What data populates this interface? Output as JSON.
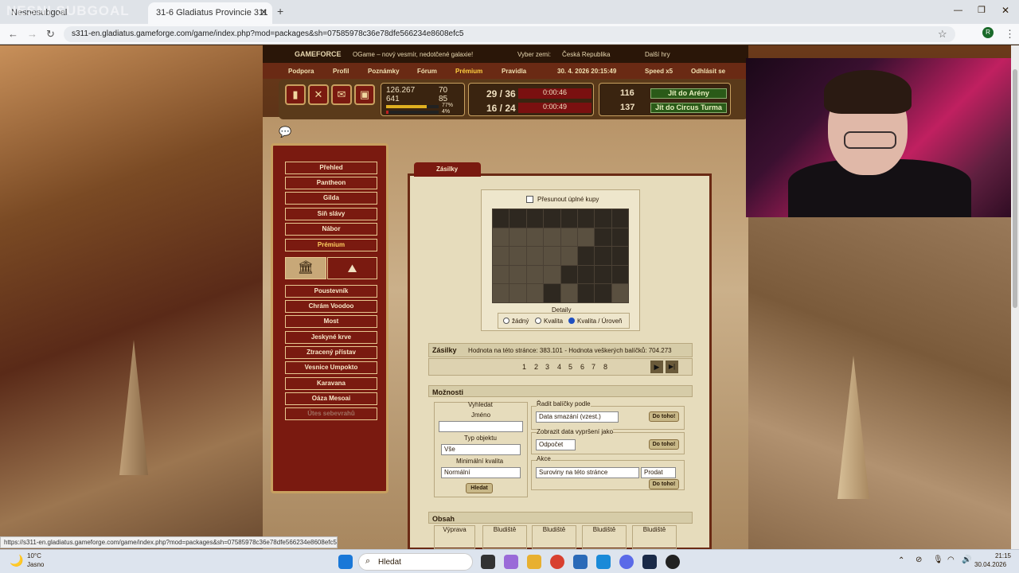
{
  "browser": {
    "tab1": "Nesnesubgoal",
    "tab2": "31-6 Gladiatus Provincie 311",
    "url": "s311-en.gladiatus.gameforge.com/game/index.php?mod=packages&sh=07585978c36e78dfe566234e8608efc5",
    "status_url": "https://s311-en.gladiatus.gameforge.com/game/index.php?mod=packages&sh=07585978c36e78dfe566234e8608efc5"
  },
  "watermark": "NESNI SUBGOAL",
  "topbar": {
    "brand": "GAMEFORCE",
    "promo": "OGame – nový vesmír, nedotčené galaxie!",
    "country_label": "Vyber zemi:",
    "country": "Česká Republika",
    "more": "Další hry"
  },
  "links": [
    "Podpora",
    "Profil",
    "Poznámky",
    "Fórum",
    "Prémium",
    "Pravidla",
    "30. 4. 2026 20:15:49",
    "Speed x5",
    "Odhlásit se"
  ],
  "hud": {
    "gold": "126.267",
    "rubies": "70",
    "honor": "641",
    "stat2": "85",
    "xp_pct": "77%",
    "hp_pct": "4%",
    "exp_now": "29 / 36",
    "exp_timer": "0:00:46",
    "dung_now": "16 / 24",
    "dung_timer": "0:00:49",
    "arena_pts": "116",
    "arena_btn": "Jít do Arény",
    "circus_pts": "137",
    "circus_btn": "Jít do Circus Turma"
  },
  "menu": {
    "main": [
      "Přehled",
      "Pantheon",
      "Gilda",
      "Síň slávy",
      "Nábor",
      "Prémium"
    ],
    "places": [
      "Poustevník",
      "Chrám Voodoo",
      "Most",
      "Jeskyné krve",
      "Ztracený přístav",
      "Vesnice Umpokto",
      "Karavana",
      "Oáza Mesoai",
      "Útes sebevrahů"
    ]
  },
  "packages": {
    "tab": "Zásilky",
    "move_full": "Přesunout úplné kupy",
    "details": "Detaily",
    "radio": [
      "žádný",
      "Kvalita",
      "Kvalita / Úroveň"
    ],
    "head": "Zásilky",
    "value_text": "Hodnota na této stránce: 383.101",
    "total_text": "- Hodnota veškerých balíčků: 704.273",
    "pages": [
      "1",
      "2",
      "3",
      "4",
      "5",
      "6",
      "7",
      "8"
    ]
  },
  "options": {
    "head": "Možnosti",
    "search": "Vyhledat",
    "name": "Jméno",
    "type_label": "Typ objektu",
    "type_val": "Vše",
    "min_q": "Minimální kvalita",
    "min_q_val": "Normální",
    "search_btn": "Hledat",
    "sort_label": "Řadit balíčky podle",
    "sort_val": "Data smazání (vzest.)",
    "go": "Do toho!",
    "expiry_label": "Zobrazit data vypršení jako",
    "expiry_val": "Odpočet",
    "action_label": "Akce",
    "action_val": "Suroviny na této stránce",
    "action2": "Prodat"
  },
  "contents": {
    "head": "Obsah",
    "items": [
      "Výprava",
      "Bludiště",
      "Bludiště",
      "Bludiště",
      "Bludiště"
    ]
  },
  "taskbar": {
    "temp": "10°C",
    "weather": "Jasno",
    "search": "Hledat",
    "time": "21:15",
    "date": "30.04.2026"
  }
}
